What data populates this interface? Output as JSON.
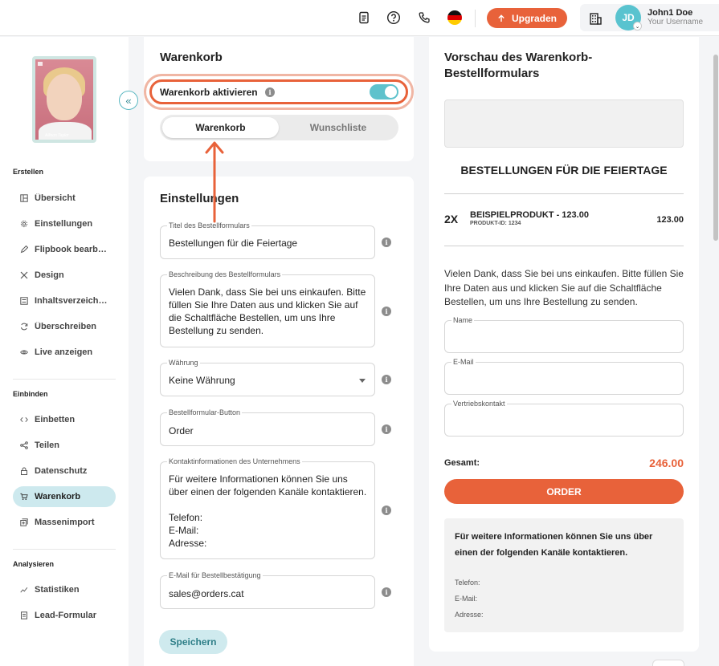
{
  "header": {
    "upgrade_label": "Upgraden",
    "user_initials": "JD",
    "user_name": "John1 Doe",
    "user_sub": "Your Username"
  },
  "sidebar": {
    "collapse_glyph": "«",
    "cover_text": "Allison Taylor",
    "sections": [
      {
        "title": "Erstellen",
        "items": [
          {
            "label": "Übersicht",
            "icon": "layout-icon"
          },
          {
            "label": "Einstellungen",
            "icon": "gear-icon"
          },
          {
            "label": "Flipbook bearbei...",
            "icon": "pencil-icon"
          },
          {
            "label": "Design",
            "icon": "tools-icon"
          },
          {
            "label": "Inhaltsverzeichnis",
            "icon": "list-icon"
          },
          {
            "label": "Überschreiben",
            "icon": "refresh-icon"
          },
          {
            "label": "Live anzeigen",
            "icon": "eye-icon"
          }
        ]
      },
      {
        "title": "Einbinden",
        "items": [
          {
            "label": "Einbetten",
            "icon": "code-icon"
          },
          {
            "label": "Teilen",
            "icon": "share-icon"
          },
          {
            "label": "Datenschutz",
            "icon": "lock-icon"
          },
          {
            "label": "Warenkorb",
            "icon": "cart-icon",
            "active": true
          },
          {
            "label": "Massenimport",
            "icon": "import-icon"
          }
        ]
      },
      {
        "title": "Analysieren",
        "items": [
          {
            "label": "Statistiken",
            "icon": "chart-icon"
          },
          {
            "label": "Lead-Formular",
            "icon": "form-icon"
          }
        ]
      }
    ]
  },
  "cart": {
    "title": "Warenkorb",
    "toggle_label": "Warenkorb aktivieren",
    "toggle_on": true,
    "tabs": [
      "Warenkorb",
      "Wunschliste"
    ],
    "active_tab": "Warenkorb"
  },
  "settings": {
    "title": "Einstellungen",
    "fields": {
      "title": {
        "label": "Titel des Bestellformulars",
        "value": "Bestellungen für die Feiertage"
      },
      "description": {
        "label": "Beschreibung des Bestellformulars",
        "lines": [
          "Vielen Dank, dass Sie bei uns einkaufen. Bitte",
          "füllen Sie Ihre Daten aus und klicken Sie auf",
          "die Schaltfläche Bestellen, um uns Ihre",
          "Bestellung zu senden."
        ]
      },
      "currency": {
        "label": "Währung",
        "value": "Keine Währung"
      },
      "button": {
        "label": "Bestellformular-Button",
        "value": "Order"
      },
      "contact": {
        "label": "Kontaktinformationen des Unternehmens",
        "lines": [
          "Für weitere Informationen können Sie uns",
          "über einen der folgenden Kanäle kontaktieren.",
          "",
          "Telefon:",
          "E-Mail:",
          "Adresse:"
        ]
      },
      "email": {
        "label": "E-Mail für Bestellbestätigung",
        "value": "sales@orders.cat"
      }
    },
    "save_label": "Speichern"
  },
  "preview": {
    "title": "Vorschau des Warenkorb-Bestellformulars",
    "heading": "BESTELLUNGEN FÜR DIE FEIERTAGE",
    "item": {
      "qty": "2X",
      "name": "BEISPIELPRODUKT -  123.00",
      "id": "PRODUKT-ID: 1234",
      "price": "123.00"
    },
    "description": "Vielen Dank, dass Sie bei uns einkaufen. Bitte füllen Sie Ihre Daten aus und klicken Sie auf die Schaltfläche Bestellen, um uns Ihre Bestellung zu senden.",
    "inputs": [
      "Name",
      "E-Mail",
      "Vertriebskontakt"
    ],
    "total_label": "Gesamt:",
    "total_value": "246.00",
    "order_label": "ORDER",
    "contact_text": "Für weitere Informationen können Sie uns über einen der folgenden Kanäle kontaktieren.",
    "contact_lines": [
      "Telefon:",
      "E-Mail:",
      "Adresse:"
    ]
  },
  "colors": {
    "accent": "#e8623a",
    "teal": "#5ec2cc",
    "active_bg": "#cde9ee"
  }
}
